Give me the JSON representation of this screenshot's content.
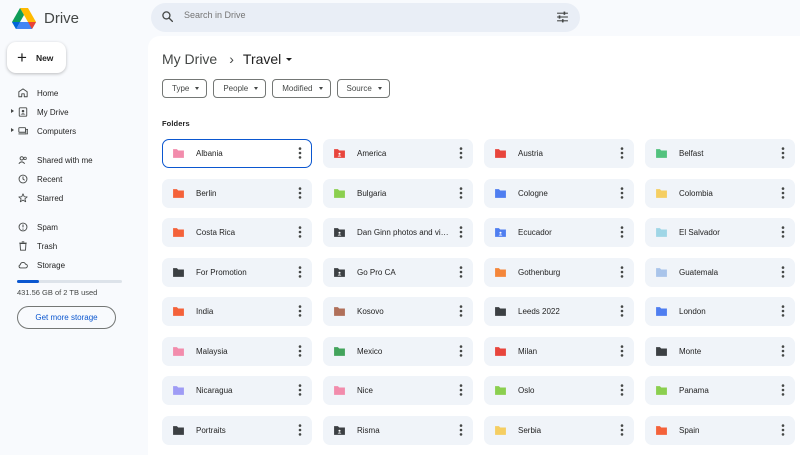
{
  "app": {
    "name": "Drive"
  },
  "search": {
    "placeholder": "Search in Drive"
  },
  "sidebar": {
    "new_label": "New",
    "items": [
      {
        "label": "Home",
        "icon": "home-icon",
        "caret": false
      },
      {
        "label": "My Drive",
        "icon": "my-drive-icon",
        "caret": true
      },
      {
        "label": "Computers",
        "icon": "computer-icon",
        "caret": true
      },
      {
        "label": "Shared with me",
        "icon": "people-icon",
        "caret": false
      },
      {
        "label": "Recent",
        "icon": "clock-icon",
        "caret": false
      },
      {
        "label": "Starred",
        "icon": "star-icon",
        "caret": false
      },
      {
        "label": "Spam",
        "icon": "spam-icon",
        "caret": false
      },
      {
        "label": "Trash",
        "icon": "trash-icon",
        "caret": false
      },
      {
        "label": "Storage",
        "icon": "cloud-icon",
        "caret": false
      }
    ],
    "storage_text": "431.56 GB of 2 TB used",
    "storage_used_fraction": 0.21,
    "more_storage_label": "Get more storage"
  },
  "breadcrumb": {
    "root": "My Drive",
    "current": "Travel"
  },
  "filters": [
    "Type",
    "People",
    "Modified",
    "Source"
  ],
  "section_title": "Folders",
  "folders": [
    {
      "name": "Albania",
      "color": "#f28cac",
      "selected": true
    },
    {
      "name": "America",
      "color": "#e8453c",
      "shared": true
    },
    {
      "name": "Austria",
      "color": "#e8453c"
    },
    {
      "name": "Belfast",
      "color": "#52c27e"
    },
    {
      "name": "Berlin",
      "color": "#f4623a"
    },
    {
      "name": "Bulgaria",
      "color": "#8bcf4f"
    },
    {
      "name": "Cologne",
      "color": "#4f7ef0"
    },
    {
      "name": "Colombia",
      "color": "#f5ce62"
    },
    {
      "name": "Costa Rica",
      "color": "#f4623a"
    },
    {
      "name": "Dan Ginn photos and videos",
      "color": "#3c4043",
      "shared": true
    },
    {
      "name": "Ecucador",
      "color": "#4f7ef0",
      "shared": true
    },
    {
      "name": "El Salvador",
      "color": "#9fd6e6"
    },
    {
      "name": "For Promotion",
      "color": "#3c4043"
    },
    {
      "name": "Go Pro CA",
      "color": "#3c4043",
      "shared": true
    },
    {
      "name": "Gothenburg",
      "color": "#f4863a"
    },
    {
      "name": "Guatemala",
      "color": "#a9c4ea"
    },
    {
      "name": "India",
      "color": "#f4623a"
    },
    {
      "name": "Kosovo",
      "color": "#b0705a"
    },
    {
      "name": "Leeds 2022",
      "color": "#3c4043"
    },
    {
      "name": "London",
      "color": "#4f7ef0"
    },
    {
      "name": "Malaysia",
      "color": "#f28cac"
    },
    {
      "name": "Mexico",
      "color": "#43a45c"
    },
    {
      "name": "Milan",
      "color": "#e8453c"
    },
    {
      "name": "Monte",
      "color": "#3c4043"
    },
    {
      "name": "Nicaragua",
      "color": "#9f9cf5"
    },
    {
      "name": "Nice",
      "color": "#f28cac"
    },
    {
      "name": "Oslo",
      "color": "#8bcf4f"
    },
    {
      "name": "Panama",
      "color": "#8bcf4f"
    },
    {
      "name": "Portraits",
      "color": "#3c4043"
    },
    {
      "name": "Risma",
      "color": "#3c4043",
      "shared": true
    },
    {
      "name": "Serbia",
      "color": "#f5ce62"
    },
    {
      "name": "Spain",
      "color": "#f4623a"
    }
  ]
}
